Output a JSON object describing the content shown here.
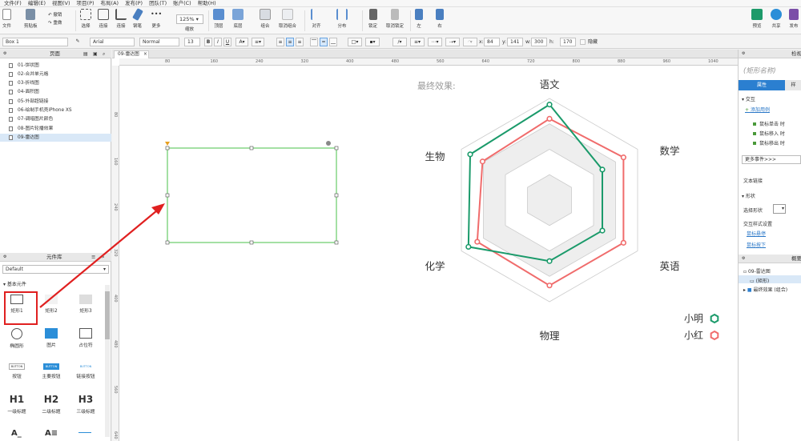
{
  "menu": [
    "文件(F)",
    "编辑(E)",
    "视图(V)",
    "项目(P)",
    "布局(A)",
    "发布(P)",
    "团队(T)",
    "账户(C)",
    "帮助(H)"
  ],
  "toolbar": {
    "file": "文件",
    "clipboard": "剪贴板",
    "undo": "撤销",
    "redo": "重做",
    "select": "选择",
    "connect": "连接",
    "pen": "钢笔",
    "more": "更多",
    "zoom_value": "125%",
    "zoom_label": "缩放",
    "top": "顶层",
    "bottom": "底层",
    "group": "组合",
    "ungroup": "取消组合",
    "align": "对齐",
    "distribute": "分布",
    "lock": "锁定",
    "unlock": "取消锁定",
    "left": "左",
    "right": "右",
    "preview": "预览",
    "share": "共享",
    "publish": "发布"
  },
  "format": {
    "shape_name": "Box 1",
    "font": "Arial",
    "style": "Normal",
    "size": "13",
    "x_label": "x:",
    "x": "84",
    "y_label": "y:",
    "y": "141",
    "w_label": "w:",
    "w": "300",
    "h_label": "h:",
    "h": "170",
    "hide": "隐藏"
  },
  "pages": {
    "title": "页面",
    "items": [
      "01-饼状图",
      "02-合并单元格",
      "03-折线图",
      "04-面积图",
      "05-外部超链接",
      "06-绘制手机壳iPhone XS",
      "07-调暗图片颜色",
      "08-图片轮播效果",
      "09-雷达图"
    ],
    "selected_index": 8
  },
  "library": {
    "title": "元件库",
    "dropdown": "Default",
    "section": "基本元件",
    "items": [
      "矩形1",
      "矩形2",
      "矩形3",
      "椭圆形",
      "图片",
      "占位符",
      "按钮",
      "主要按钮",
      "链接按钮",
      "一级标题",
      "二级标题",
      "三级标题"
    ],
    "button_text": "BUTTON",
    "h1": "H1",
    "h2": "H2",
    "h3": "H3"
  },
  "canvas": {
    "tab": "09-雷达图",
    "hruler": [
      "80",
      "160",
      "240",
      "320",
      "400",
      "480",
      "560",
      "640",
      "720",
      "800",
      "880",
      "960",
      "1040"
    ],
    "vruler": [
      "80",
      "160",
      "240",
      "320",
      "400",
      "480",
      "560",
      "640"
    ]
  },
  "chart_data": {
    "type": "radar",
    "title": "最终效果:",
    "axes": [
      "语文",
      "数学",
      "英语",
      "物理",
      "化学",
      "生物"
    ],
    "rmax": 1,
    "levels": 4,
    "series": [
      {
        "name": "小明",
        "color": "#1a9a6a",
        "values": [
          0.94,
          0.6,
          0.6,
          0.6,
          0.92,
          0.9
        ]
      },
      {
        "name": "小红",
        "color": "#f06c6c",
        "values": [
          0.8,
          0.84,
          0.84,
          0.84,
          0.82,
          0.76
        ]
      }
    ]
  },
  "right": {
    "header": "检视",
    "shape_name_placeholder": "(矩形名称)",
    "tab_props": "属性",
    "tab_style": "样",
    "interaction": "交互",
    "add_case": "添加用例",
    "events": [
      "鼠标单击 时",
      "鼠标移入 时",
      "鼠标移出 时"
    ],
    "more_events": "更多事件>>>",
    "text_link": "文本链接",
    "shape": "形状",
    "select_shape": "选择形状",
    "interaction_style": "交互样式设置",
    "mouse_hover": "鼠标悬停",
    "mouse_down": "鼠标按下",
    "outline_header": "概要",
    "outline_page": "09-雷达图",
    "outline_rect": "(矩形)",
    "outline_group": "最终效果 (组合)"
  },
  "colors": {
    "accent": "#2b7fd0",
    "selection": "#4ac24a",
    "arrow": "#e02020"
  }
}
